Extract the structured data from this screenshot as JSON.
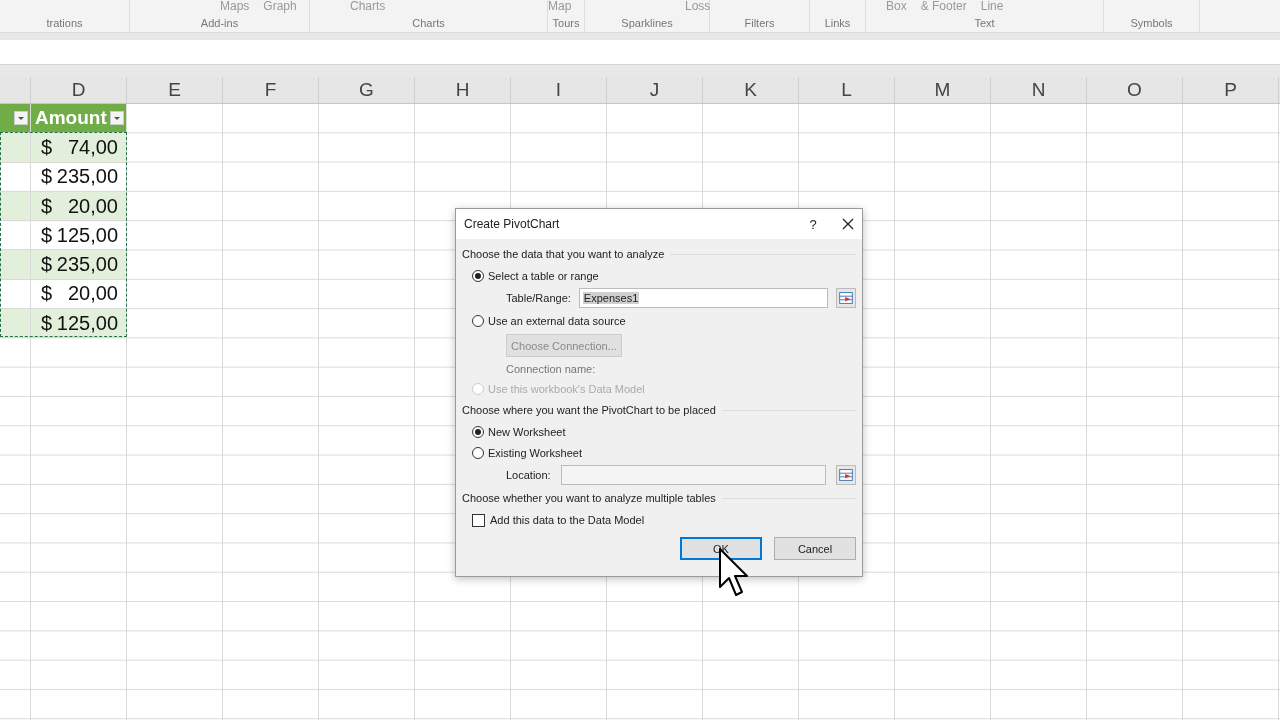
{
  "ribbon": {
    "groups": [
      {
        "label": "trations"
      },
      {
        "label": "Add-ins",
        "items": [
          "Maps",
          "Graph"
        ]
      },
      {
        "label": "Charts",
        "items": [
          "Charts"
        ]
      },
      {
        "label": "Tours",
        "items": [
          "Map"
        ]
      },
      {
        "label": "Sparklines",
        "items": [
          "Loss"
        ]
      },
      {
        "label": "Filters"
      },
      {
        "label": "Links"
      },
      {
        "label": "Text",
        "items": [
          "Box",
          "& Footer",
          "Line"
        ]
      },
      {
        "label": "Symbols"
      }
    ]
  },
  "sheet": {
    "columns": [
      "D",
      "E",
      "F",
      "G",
      "H",
      "I",
      "J",
      "K",
      "L",
      "M",
      "N",
      "O",
      "P"
    ],
    "table": {
      "header": "Amount",
      "rows": [
        {
          "currency": "$",
          "amount": "74,00"
        },
        {
          "currency": "$",
          "amount": "235,00"
        },
        {
          "currency": "$",
          "amount": "20,00"
        },
        {
          "currency": "$",
          "amount": "125,00"
        },
        {
          "currency": "$",
          "amount": "235,00"
        },
        {
          "currency": "$",
          "amount": "20,00"
        },
        {
          "currency": "$",
          "amount": "125,00"
        }
      ]
    }
  },
  "dialog": {
    "title": "Create PivotChart",
    "help": "?",
    "source_heading": "Choose the data that you want to analyze",
    "source_options": [
      {
        "label": "Select a table or range",
        "selected": true,
        "disabled": false
      },
      {
        "label": "Use an external data source",
        "selected": false,
        "disabled": false
      },
      {
        "label": "Use this workbook's Data Model",
        "selected": false,
        "disabled": true
      }
    ],
    "range_label": "Table/Range:",
    "range_value": "Expenses1",
    "connection_button": {
      "label": "Choose Connection...",
      "disabled": true
    },
    "connection_name": "Connection name:",
    "place_heading": "Choose where you want the PivotChart to be placed",
    "place_options": [
      {
        "label": "New Worksheet",
        "selected": true
      },
      {
        "label": "Existing Worksheet",
        "selected": false
      }
    ],
    "location_label": "Location:",
    "tables_heading": "Choose whether you want to analyze multiple tables",
    "data_model": {
      "label": "Add this data to the Data Model",
      "checked": false
    },
    "buttons": [
      {
        "label": "OK",
        "default": true
      },
      {
        "label": "Cancel",
        "default": false
      }
    ]
  }
}
